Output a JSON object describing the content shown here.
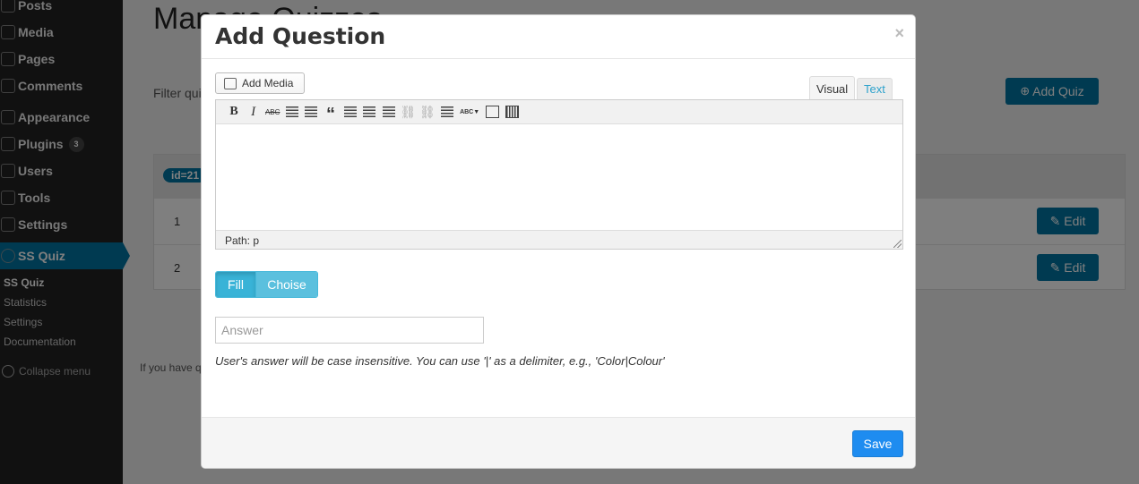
{
  "sidebar": {
    "items": [
      {
        "label": "Posts",
        "icon": "pin-icon"
      },
      {
        "label": "Media",
        "icon": "media-icon"
      },
      {
        "label": "Pages",
        "icon": "pages-icon"
      },
      {
        "label": "Comments",
        "icon": "comments-icon"
      },
      {
        "label": "Appearance",
        "icon": "appearance-icon"
      },
      {
        "label": "Plugins",
        "icon": "plugins-icon",
        "badge": "3"
      },
      {
        "label": "Users",
        "icon": "users-icon"
      },
      {
        "label": "Tools",
        "icon": "tools-icon"
      },
      {
        "label": "Settings",
        "icon": "settings-icon"
      },
      {
        "label": "SS Quiz",
        "icon": "quiz-icon"
      }
    ],
    "submenu": [
      "SS Quiz",
      "Statistics",
      "Settings",
      "Documentation"
    ],
    "collapse_label": "Collapse menu"
  },
  "page": {
    "title": "Manage Quizzes",
    "filter_label": "Filter quizzes",
    "add_quiz_label": "Add Quiz",
    "id_badge": "id=21",
    "rows": [
      {
        "num": "1",
        "edit_label": "Edit"
      },
      {
        "num": "2",
        "edit_label": "Edit"
      }
    ],
    "footer_note": "If you have questions"
  },
  "modal": {
    "title": "Add Question",
    "close": "×",
    "add_media_label": "Add Media",
    "tabs": {
      "visual": "Visual",
      "text": "Text"
    },
    "toolbar": {
      "bold": "B",
      "italic": "I",
      "strike": "ABC",
      "quote": "“",
      "spell": "ABC"
    },
    "status_path": "Path: p",
    "type_toggle": {
      "fill": "Fill",
      "choise": "Choise",
      "selected": "Fill"
    },
    "answer_placeholder": "Answer",
    "hint": "User's answer will be case insensitive. You can use '|' as a delimiter, e.g., 'Color|Colour'",
    "save_label": "Save"
  },
  "colors": {
    "wp_blue": "#0074a2",
    "info": "#5bc0de",
    "info_active": "#39b3d7",
    "primary": "#1e8cf0",
    "sidebar_bg": "#222222"
  }
}
